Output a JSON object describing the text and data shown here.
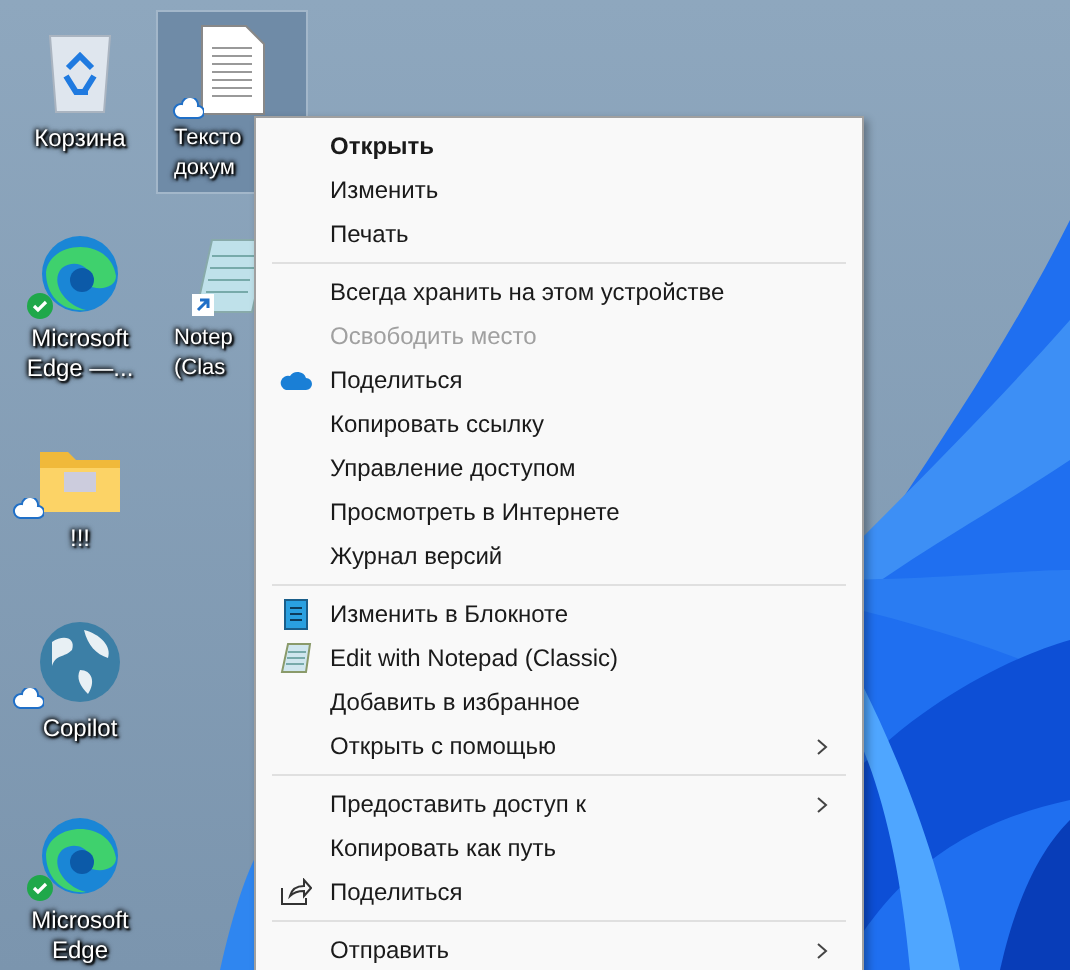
{
  "desktop_icons": [
    {
      "kind": "recycle_bin",
      "label": [
        "Корзина"
      ],
      "selected": false,
      "synced": false,
      "checked": false,
      "shortcut": false
    },
    {
      "kind": "text_file",
      "label": [
        "Тексто",
        "докум"
      ],
      "selected": true,
      "synced": true,
      "checked": false,
      "shortcut": false
    },
    {
      "kind": "edge",
      "label": [
        "Microsoft",
        "Edge —..."
      ],
      "selected": false,
      "synced": false,
      "checked": true,
      "shortcut": false
    },
    {
      "kind": "notepad",
      "label": [
        "Notep",
        "(Clas"
      ],
      "selected": false,
      "synced": false,
      "checked": false,
      "shortcut": true
    },
    {
      "kind": "folder",
      "label": [
        "!!!"
      ],
      "selected": false,
      "synced": true,
      "checked": false,
      "shortcut": false
    },
    {
      "kind": "globe",
      "label": [
        "Copilot"
      ],
      "selected": false,
      "synced": true,
      "checked": false,
      "shortcut": false
    },
    {
      "kind": "edge",
      "label": [
        "Microsoft",
        "Edge"
      ],
      "selected": false,
      "synced": false,
      "checked": true,
      "shortcut": false
    }
  ],
  "context_menu": {
    "items": [
      {
        "kind": "plain",
        "label": "Открыть",
        "default": true,
        "disabled": false,
        "submenu": false
      },
      {
        "kind": "plain",
        "label": "Изменить",
        "default": false,
        "disabled": false,
        "submenu": false
      },
      {
        "kind": "plain",
        "label": "Печать",
        "default": false,
        "disabled": false,
        "submenu": false
      },
      {
        "kind": "separator"
      },
      {
        "kind": "plain",
        "label": "Всегда хранить на этом устройстве",
        "default": false,
        "disabled": false,
        "submenu": false
      },
      {
        "kind": "plain",
        "label": "Освободить место",
        "default": false,
        "disabled": true,
        "submenu": false
      },
      {
        "kind": "cloud",
        "label": "Поделиться",
        "default": false,
        "disabled": false,
        "submenu": false
      },
      {
        "kind": "plain",
        "label": "Копировать ссылку",
        "default": false,
        "disabled": false,
        "submenu": false
      },
      {
        "kind": "plain",
        "label": "Управление доступом",
        "default": false,
        "disabled": false,
        "submenu": false
      },
      {
        "kind": "plain",
        "label": "Просмотреть в Интернете",
        "default": false,
        "disabled": false,
        "submenu": false
      },
      {
        "kind": "plain",
        "label": "Журнал версий",
        "default": false,
        "disabled": false,
        "submenu": false
      },
      {
        "kind": "separator"
      },
      {
        "kind": "notepad",
        "label": "Изменить в Блокноте",
        "default": false,
        "disabled": false,
        "submenu": false
      },
      {
        "kind": "notepad_classic",
        "label": "Edit with Notepad (Classic)",
        "default": false,
        "disabled": false,
        "submenu": false
      },
      {
        "kind": "plain",
        "label": "Добавить в избранное",
        "default": false,
        "disabled": false,
        "submenu": false
      },
      {
        "kind": "plain",
        "label": "Открыть с помощью",
        "default": false,
        "disabled": false,
        "submenu": true
      },
      {
        "kind": "separator"
      },
      {
        "kind": "plain",
        "label": "Предоставить доступ к",
        "default": false,
        "disabled": false,
        "submenu": true
      },
      {
        "kind": "plain",
        "label": "Копировать как путь",
        "default": false,
        "disabled": false,
        "submenu": false
      },
      {
        "kind": "share",
        "label": "Поделиться",
        "default": false,
        "disabled": false,
        "submenu": false
      },
      {
        "kind": "separator"
      },
      {
        "kind": "plain",
        "label": "Отправить",
        "default": false,
        "disabled": false,
        "submenu": true
      }
    ]
  }
}
